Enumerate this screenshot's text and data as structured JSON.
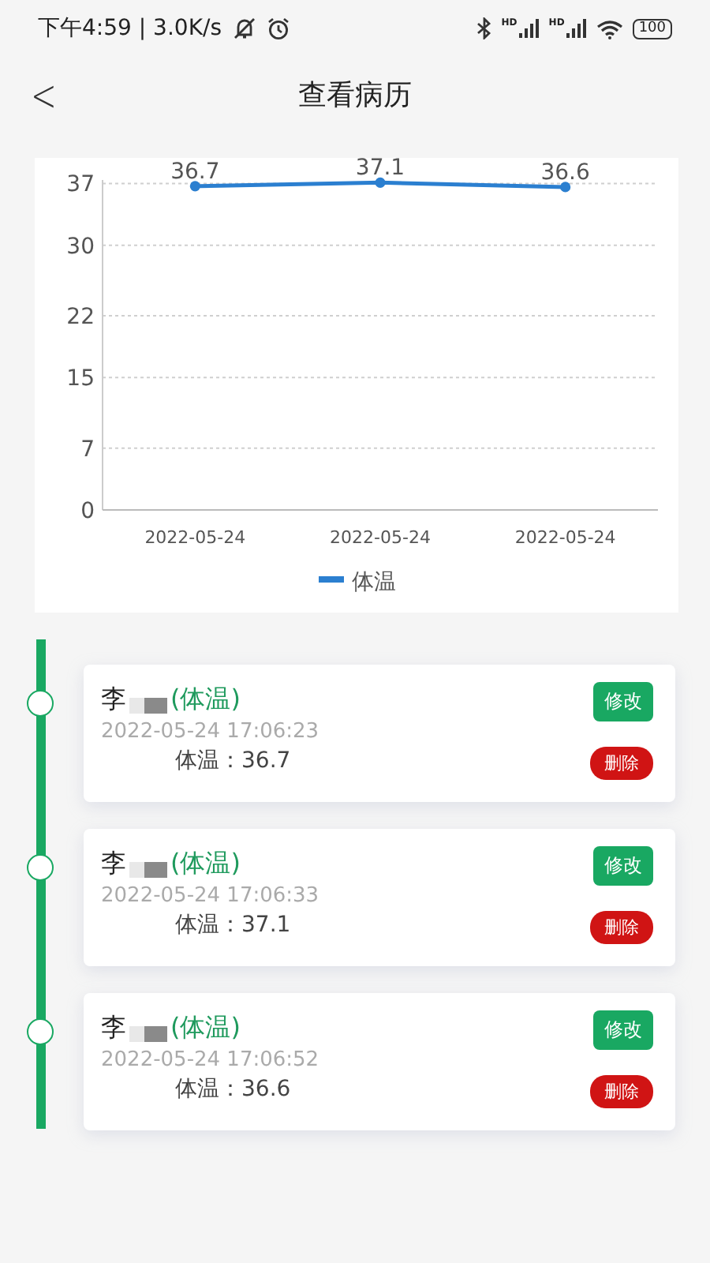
{
  "status_bar": {
    "time": "下午4:59 | 3.0K/s",
    "signal_labels": [
      "HD",
      "HD"
    ],
    "battery": "100"
  },
  "header": {
    "back": "<",
    "title": "查看病历"
  },
  "chart": {
    "chart_data": {
      "type": "line",
      "categories": [
        "2022-05-24",
        "2022-05-24",
        "2022-05-24"
      ],
      "series": [
        {
          "name": "体温",
          "color": "#2b7fd0",
          "values": [
            36.7,
            37.1,
            36.6
          ]
        }
      ],
      "ylim": [
        0,
        37.4
      ],
      "yticks": [
        0,
        7,
        15,
        22,
        30,
        37
      ],
      "grid": true,
      "marker": true,
      "data_labels": true
    }
  },
  "records": [
    {
      "name": "李",
      "type": "(体温)",
      "time": "2022-05-24 17:06:23",
      "reading": "体温：36.7",
      "edit": "修改",
      "delete": "删除"
    },
    {
      "name": "李",
      "type": "(体温)",
      "time": "2022-05-24 17:06:33",
      "reading": "体温：37.1",
      "edit": "修改",
      "delete": "删除"
    },
    {
      "name": "李",
      "type": "(体温)",
      "time": "2022-05-24 17:06:52",
      "reading": "体温：36.6",
      "edit": "修改",
      "delete": "删除"
    }
  ]
}
